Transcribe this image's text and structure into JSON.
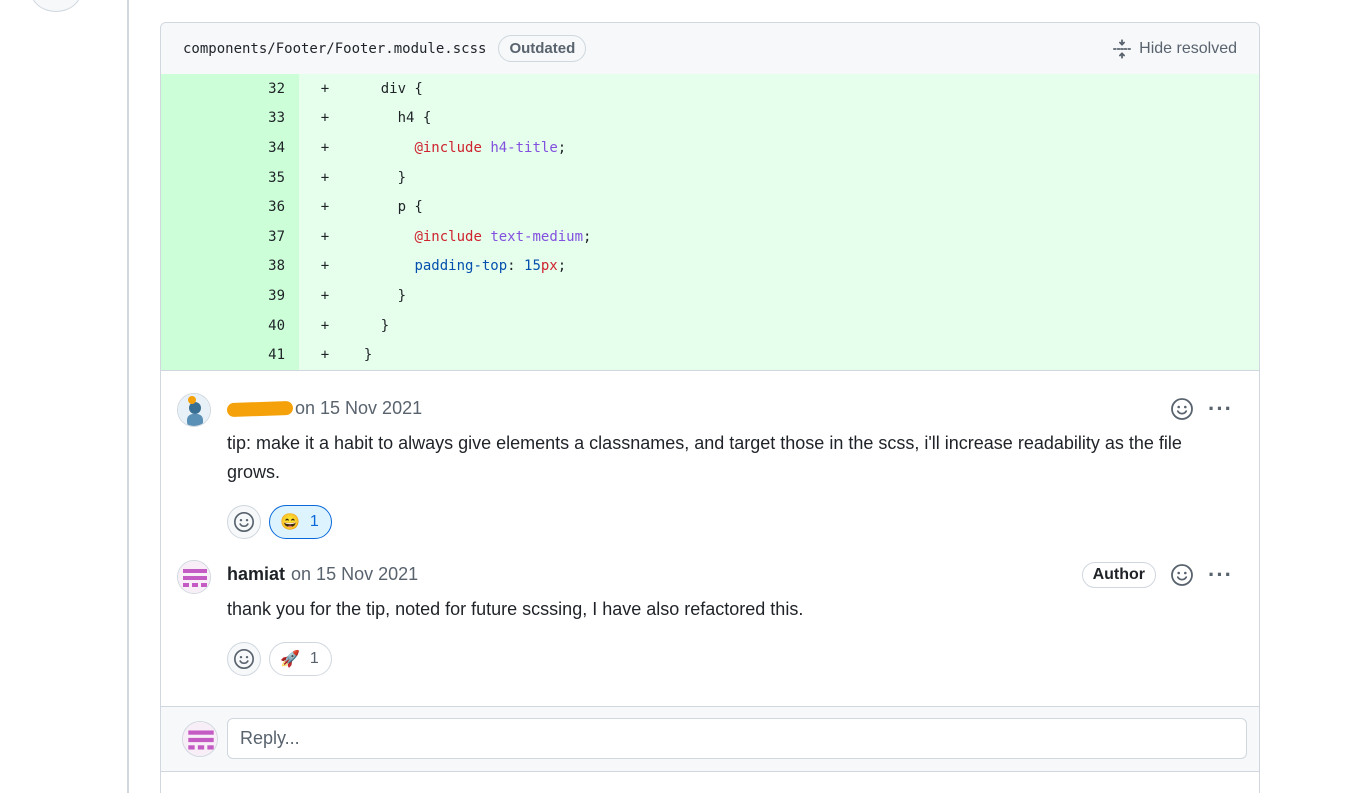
{
  "file": {
    "path": "components/Footer/Footer.module.scss",
    "status_badge": "Outdated",
    "hide_resolved_label": "Hide resolved",
    "hide_resolved_icon": "fold-icon"
  },
  "code": {
    "lines": [
      {
        "number": "32",
        "marker": "+",
        "text": "    div {"
      },
      {
        "number": "33",
        "marker": "+",
        "text": "      h4 {"
      },
      {
        "number": "34",
        "marker": "+",
        "text": "        @include h4-title;"
      },
      {
        "number": "35",
        "marker": "+",
        "text": "      }"
      },
      {
        "number": "36",
        "marker": "+",
        "text": "      p {"
      },
      {
        "number": "37",
        "marker": "+",
        "text": "        @include text-medium;"
      },
      {
        "number": "38",
        "marker": "+",
        "text": "        padding-top: 15px;"
      },
      {
        "number": "39",
        "marker": "+",
        "text": "      }"
      },
      {
        "number": "40",
        "marker": "+",
        "text": "    }"
      },
      {
        "number": "41",
        "marker": "+",
        "text": "  }"
      }
    ]
  },
  "comments": [
    {
      "author": "",
      "author_redacted": true,
      "date": "on 15 Nov 2021",
      "body": "tip: make it a habit to always give elements a classnames, and target those in the scss, i'll increase readability as the file grows.",
      "reaction": {
        "emoji": "😄",
        "count": "1"
      }
    },
    {
      "author": "hamiat",
      "badge": "Author",
      "date": "on 15 Nov 2021",
      "body": "thank you for the tip, noted for future scssing, I have also refactored this.",
      "reaction": {
        "emoji": "🚀",
        "count": "1"
      }
    }
  ],
  "reply": {
    "placeholder": "Reply..."
  },
  "icons": {
    "add_reaction": "smiley-icon",
    "more": "kebab-horizontal-icon"
  },
  "colors": {
    "added_line_bg": "#e6ffec",
    "added_number_bg": "#ccffd8",
    "active_reaction": "#0969da",
    "redaction": "#f5a10a"
  }
}
